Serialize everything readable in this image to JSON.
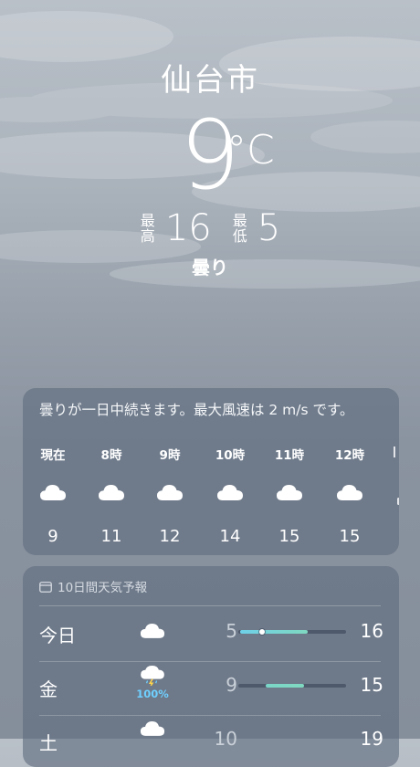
{
  "location": {
    "city": "仙台市",
    "temperature": "9",
    "unit": "°C",
    "high_label": "最高",
    "high": "16",
    "low_label": "最低",
    "low": "5",
    "condition": "曇り"
  },
  "hourly": {
    "summary": "曇りが一日中続きます。最大風速は 2 m/s です。",
    "items": [
      {
        "time": "現在",
        "icon": "cloud-icon",
        "temp": "9"
      },
      {
        "time": "8時",
        "icon": "cloud-icon",
        "temp": "11"
      },
      {
        "time": "9時",
        "icon": "cloud-icon",
        "temp": "12"
      },
      {
        "time": "10時",
        "icon": "cloud-icon",
        "temp": "14"
      },
      {
        "time": "11時",
        "icon": "cloud-icon",
        "temp": "15"
      },
      {
        "time": "12時",
        "icon": "cloud-icon",
        "temp": "15"
      }
    ]
  },
  "forecast": {
    "title": "10日間天気予報",
    "days": [
      {
        "day": "今日",
        "icon": "cloud-icon",
        "precip": "",
        "low": "5",
        "high": "16",
        "current": "9"
      },
      {
        "day": "金",
        "icon": "thunderstorm-icon",
        "precip": "100%",
        "low": "9",
        "high": "15",
        "current": ""
      },
      {
        "day": "土",
        "icon": "cloud-icon",
        "precip": "",
        "low": "10",
        "high": "19",
        "current": ""
      }
    ]
  },
  "colors": {
    "bar_track": "#2d3a4c",
    "bar_gradient_start": "#6fd0e8",
    "bar_gradient_end": "#7fd8c0",
    "precip": "#6fd0ff"
  }
}
